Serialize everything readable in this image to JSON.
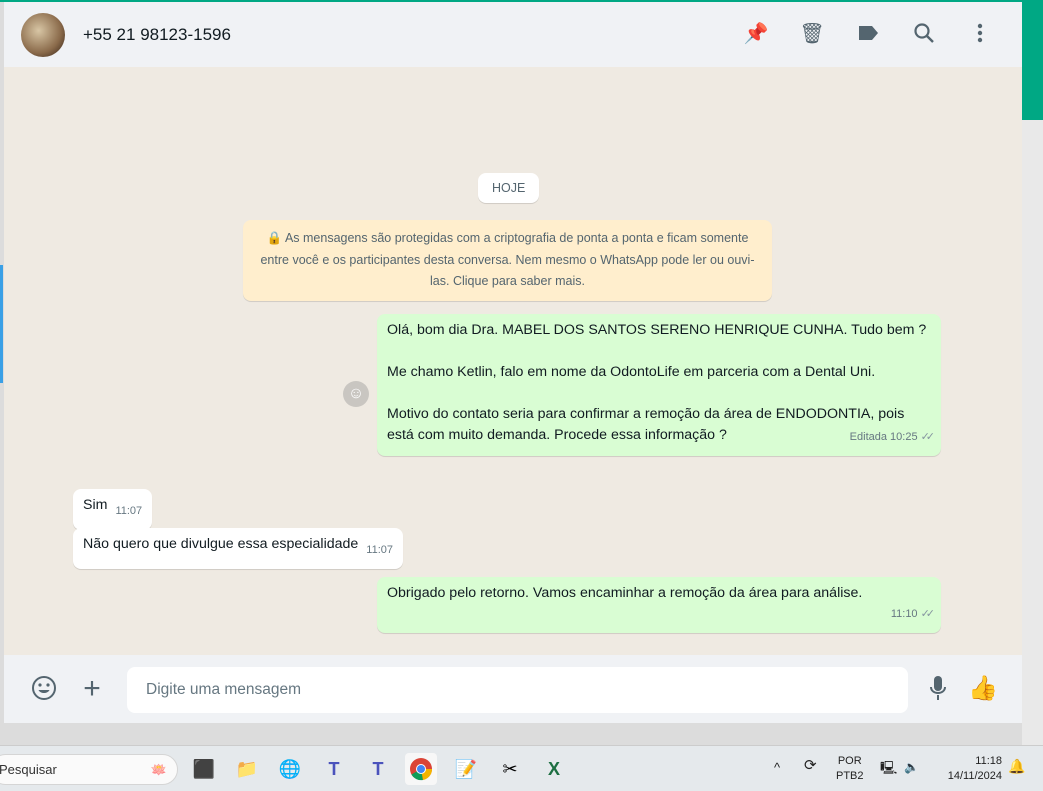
{
  "header": {
    "contact": "+55 21 98123-1596",
    "icons": [
      "pin-icon",
      "delete-icon",
      "label-icon",
      "search-icon",
      "menu-icon"
    ]
  },
  "chat": {
    "date": "HOJE",
    "encryption": "🔒 As mensagens são protegidas com a criptografia de ponta a ponta e ficam somente entre você e os participantes desta conversa. Nem mesmo o WhatsApp pode ler ou ouvi-las. Clique para saber mais.",
    "messages": [
      {
        "dir": "out",
        "p1": "Olá, bom dia Dra. MABEL DOS SANTOS SERENO HENRIQUE CUNHA. Tudo bem ?",
        "p2": "Me chamo Ketlin, falo em nome da OdontoLife em parceria com a Dental Uni.",
        "p3": "Motivo do contato seria para confirmar a remoção da área de ENDODONTIA, pois está com muito demanda. Procede essa informação ?",
        "time": "Editada 10:25"
      },
      {
        "dir": "in",
        "text": "Sim",
        "time": "11:07"
      },
      {
        "dir": "in",
        "text": "Não quero que divulgue essa especialidade",
        "time": "11:07"
      },
      {
        "dir": "out",
        "text": "Obrigado pelo retorno. Vamos encaminhar a remoção da área para análise.",
        "time": "11:10"
      }
    ]
  },
  "footer": {
    "placeholder": "Digite uma mensagem"
  },
  "taskbar": {
    "search": "Pesquisar",
    "lang1": "POR",
    "lang2": "PTB2",
    "time": "11:18",
    "date": "14/11/2024"
  }
}
